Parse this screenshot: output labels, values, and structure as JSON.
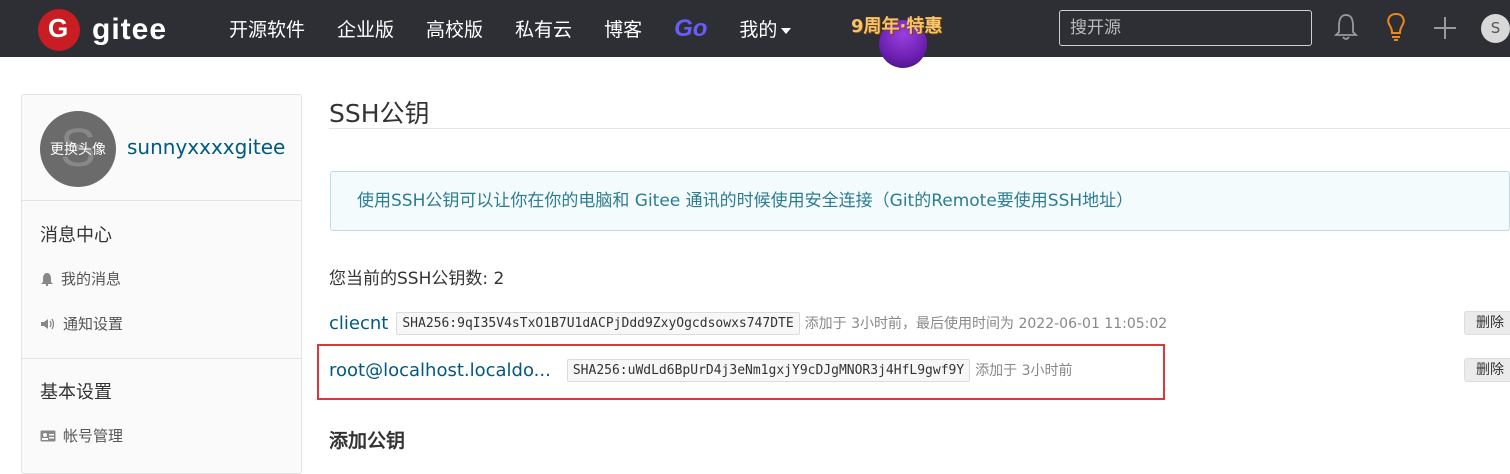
{
  "brand": {
    "logo_letter": "G",
    "name": "gitee"
  },
  "nav": {
    "items": [
      "开源软件",
      "企业版",
      "高校版",
      "私有云",
      "博客"
    ],
    "go_label": "Go",
    "mine_label": "我的",
    "promo_label": "9周年·特惠"
  },
  "search": {
    "placeholder": "搜开源"
  },
  "user": {
    "avatar_letter": "S"
  },
  "profile": {
    "initial": "S",
    "change_avatar_label": "更换头像",
    "username": "sunnyxxxxgitee"
  },
  "sidebar": {
    "messages_title": "消息中心",
    "my_messages": "我的消息",
    "notify_settings": "通知设置",
    "basic_title": "基本设置",
    "account_mgmt": "帐号管理"
  },
  "main": {
    "title": "SSH公钥",
    "info": "使用SSH公钥可以让你在你的电脑和 Gitee 通讯的时候使用安全连接（Git的Remote要使用SSH地址）",
    "count_label": "您当前的SSH公钥数: 2",
    "add_title": "添加公钥"
  },
  "keys": [
    {
      "name": "cliecnt",
      "fingerprint": "SHA256:9qI35V4sTxO1B7U1dACPjDdd9ZxyOgcdsowxs747DTE",
      "meta": "添加于 3小时前，最后使用时间为 2022-06-01 11:05:02",
      "delete_label": "删除"
    },
    {
      "name": "root@localhost.localdo...",
      "fingerprint": "SHA256:uWdLd6BpUrD4j3eNm1gxjY9cDJgMNOR3j4HfL9gwf9Y",
      "meta": "添加于 3小时前",
      "delete_label": "删除"
    }
  ],
  "colors": {
    "topbar": "#2d2f34",
    "brand_red": "#c71d23",
    "link": "#005980",
    "highlight": "#d9393d"
  }
}
